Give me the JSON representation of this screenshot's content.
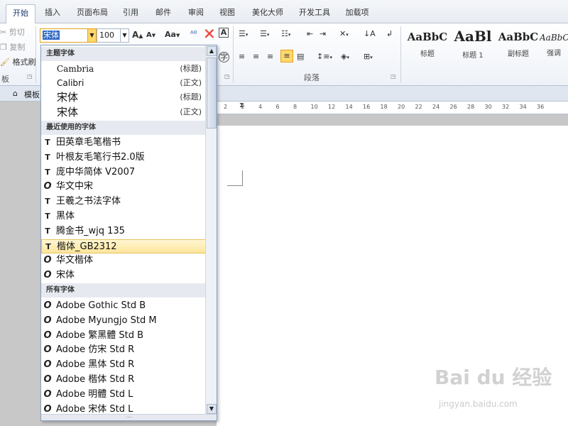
{
  "tabs": [
    {
      "label": "开始",
      "active": true
    },
    {
      "label": "插入"
    },
    {
      "label": "页面布局"
    },
    {
      "label": "引用"
    },
    {
      "label": "邮件"
    },
    {
      "label": "审阅"
    },
    {
      "label": "视图"
    },
    {
      "label": "美化大师"
    },
    {
      "label": "开发工具"
    },
    {
      "label": "加载项"
    }
  ],
  "clipboard": {
    "cut": "剪切",
    "copy": "复制",
    "format_painter": "格式刷",
    "group_label": "板"
  },
  "font": {
    "name": "宋体",
    "size": "100",
    "grow": "A",
    "shrink": "A",
    "case": "Aa"
  },
  "paragraph": {
    "group_label": "段落"
  },
  "styles": [
    {
      "sample": "AaBbC",
      "name": "标题"
    },
    {
      "sample": "AaBl",
      "name": "标题 1"
    },
    {
      "sample": "AaBbC",
      "name": "副标题"
    },
    {
      "sample": "AaBbCc",
      "name": "强调"
    }
  ],
  "subtab": {
    "label": "模板"
  },
  "ruler": {
    "ticks": [
      "2",
      "2",
      "4",
      "6",
      "8",
      "10",
      "12",
      "14",
      "16",
      "18",
      "20",
      "22",
      "24",
      "26",
      "28",
      "30",
      "32",
      "34",
      "36"
    ]
  },
  "dropdown": {
    "theme_header": "主题字体",
    "theme_fonts": [
      {
        "name": "Cambria",
        "tag": "(标题)"
      },
      {
        "name": "Calibri",
        "tag": "(正文)"
      },
      {
        "name": "宋体",
        "tag": "(标题)"
      },
      {
        "name": "宋体",
        "tag": "(正文)"
      }
    ],
    "recent_header": "最近使用的字体",
    "recent_fonts": [
      {
        "name": "田英章毛笔楷书",
        "icon": "T"
      },
      {
        "name": "叶根友毛笔行书2.0版",
        "icon": "T"
      },
      {
        "name": "庞中华简体 V2007",
        "icon": "T"
      },
      {
        "name": "华文中宋",
        "icon": "O"
      },
      {
        "name": "王羲之书法字体",
        "icon": "T"
      },
      {
        "name": "黑体",
        "icon": "T"
      },
      {
        "name": "腾金书_wjq 135",
        "icon": "T"
      },
      {
        "name": "楷体_GB2312",
        "icon": "T",
        "highlighted": true
      },
      {
        "name": "华文楷体",
        "icon": "O"
      },
      {
        "name": "宋体",
        "icon": "O"
      }
    ],
    "all_header": "所有字体",
    "all_fonts": [
      {
        "name": "Adobe Gothic Std B",
        "icon": "O"
      },
      {
        "name": "Adobe Myungjo Std M",
        "icon": "O"
      },
      {
        "name": "Adobe 繁黑體 Std B",
        "icon": "O"
      },
      {
        "name": "Adobe 仿宋 Std R",
        "icon": "O"
      },
      {
        "name": "Adobe 黑体 Std R",
        "icon": "O"
      },
      {
        "name": "Adobe 楷体 Std R",
        "icon": "O"
      },
      {
        "name": "Adobe 明體 Std L",
        "icon": "O"
      },
      {
        "name": "Adobe 宋体 Std L",
        "icon": "O"
      }
    ]
  },
  "watermark": {
    "main": "Bai du 经验",
    "sub": "jingyan.baidu.com"
  }
}
